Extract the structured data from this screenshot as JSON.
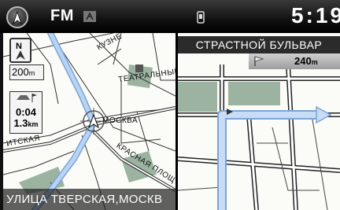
{
  "status_bar": {
    "audio_source": "FM",
    "clock": "5:19",
    "home_icon": "compass-icon",
    "signal_icon": "radio-signal-icon",
    "phone_icon": "phone-icon"
  },
  "left_map": {
    "north_button_icon": "north-arrow-icon",
    "scale_value": "200",
    "scale_unit": "m",
    "trip": {
      "icon": "car-flag-icon",
      "time": "0:04",
      "distance_value": "1.3",
      "distance_unit": "km"
    },
    "labels": {
      "kuznetsky": "КУЗНЕ",
      "teatralny": "ТЕАТРАЛЬНЫЙ П",
      "moskva": "МОСКВА",
      "krasnaya": "КРАСНАЯ ПЛОЩ",
      "tverskaya_side": "ИТСКАЯ"
    },
    "current_street": "УЛИЦА ТВЕРСКАЯ,МОСКВ"
  },
  "right_map": {
    "next_street": "СТРАСТНОЙ БУЛЬВАР",
    "next_distance_value": "240",
    "next_distance_unit": "m",
    "flag_icon": "flag-icon"
  },
  "colors": {
    "route": "#a8c8ee",
    "road": "#222222",
    "park": "#9bb3a0",
    "background": "#fbfbf7",
    "street_banner": "#2b2b2b"
  }
}
